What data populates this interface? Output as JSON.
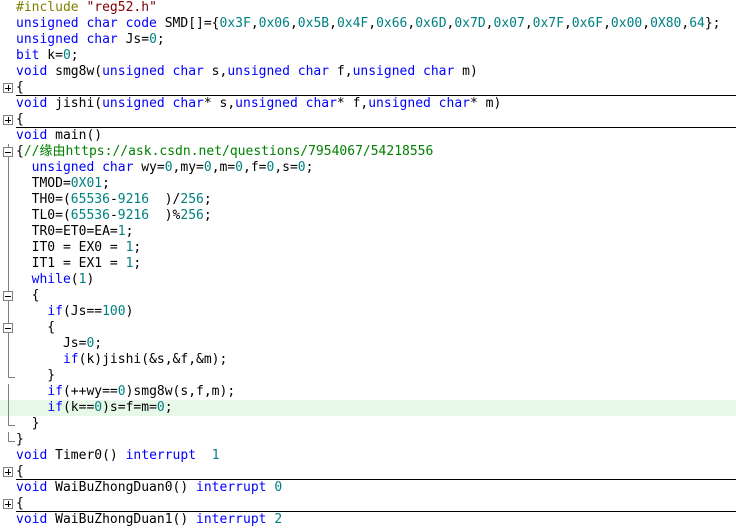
{
  "editor": {
    "lines": [
      {
        "fold": "",
        "hl": false,
        "sep": false,
        "tokens": [
          [
            "pp",
            "#include "
          ],
          [
            "str",
            "\"reg52.h\""
          ]
        ]
      },
      {
        "fold": "",
        "hl": false,
        "sep": false,
        "tokens": [
          [
            "kw",
            "unsigned char code"
          ],
          [
            "id",
            " SMD[]={"
          ],
          [
            "num",
            "0x3F"
          ],
          [
            "id",
            ","
          ],
          [
            "num",
            "0x06"
          ],
          [
            "id",
            ","
          ],
          [
            "num",
            "0x5B"
          ],
          [
            "id",
            ","
          ],
          [
            "num",
            "0x4F"
          ],
          [
            "id",
            ","
          ],
          [
            "num",
            "0x66"
          ],
          [
            "id",
            ","
          ],
          [
            "num",
            "0x6D"
          ],
          [
            "id",
            ","
          ],
          [
            "num",
            "0x7D"
          ],
          [
            "id",
            ","
          ],
          [
            "num",
            "0x07"
          ],
          [
            "id",
            ","
          ],
          [
            "num",
            "0x7F"
          ],
          [
            "id",
            ","
          ],
          [
            "num",
            "0x6F"
          ],
          [
            "id",
            ","
          ],
          [
            "num",
            "0x00"
          ],
          [
            "id",
            ","
          ],
          [
            "num",
            "0X80"
          ],
          [
            "id",
            ","
          ],
          [
            "num",
            "64"
          ],
          [
            "id",
            "};"
          ]
        ]
      },
      {
        "fold": "",
        "hl": false,
        "sep": false,
        "tokens": [
          [
            "kw",
            "unsigned char"
          ],
          [
            "id",
            " Js="
          ],
          [
            "num",
            "0"
          ],
          [
            "id",
            ";"
          ]
        ]
      },
      {
        "fold": "",
        "hl": false,
        "sep": false,
        "tokens": [
          [
            "kw",
            "bit"
          ],
          [
            "id",
            " k="
          ],
          [
            "num",
            "0"
          ],
          [
            "id",
            ";"
          ]
        ]
      },
      {
        "fold": "",
        "hl": false,
        "sep": false,
        "tokens": [
          [
            "kw",
            "void"
          ],
          [
            "id",
            " smg8w("
          ],
          [
            "kw",
            "unsigned char"
          ],
          [
            "id",
            " s,"
          ],
          [
            "kw",
            "unsigned char"
          ],
          [
            "id",
            " f,"
          ],
          [
            "kw",
            "unsigned char"
          ],
          [
            "id",
            " m)"
          ]
        ]
      },
      {
        "fold": "plus",
        "hl": false,
        "sep": false,
        "tokens": [
          [
            "id",
            "{"
          ]
        ]
      },
      {
        "fold": "",
        "hl": false,
        "sep": true,
        "tokens": [
          [
            "kw",
            "void"
          ],
          [
            "id",
            " jishi("
          ],
          [
            "kw",
            "unsigned char"
          ],
          [
            "id",
            "* s,"
          ],
          [
            "kw",
            "unsigned char"
          ],
          [
            "id",
            "* f,"
          ],
          [
            "kw",
            "unsigned char"
          ],
          [
            "id",
            "* m)"
          ]
        ]
      },
      {
        "fold": "plus",
        "hl": false,
        "sep": false,
        "tokens": [
          [
            "id",
            "{"
          ]
        ]
      },
      {
        "fold": "",
        "hl": false,
        "sep": true,
        "tokens": [
          [
            "kw",
            "void"
          ],
          [
            "id",
            " main()"
          ]
        ]
      },
      {
        "fold": "minus",
        "hl": false,
        "sep": false,
        "tokens": [
          [
            "id",
            "{"
          ],
          [
            "cm",
            "//缘由https://ask.csdn.net/questions/7954067/54218556"
          ]
        ]
      },
      {
        "fold": "line",
        "hl": false,
        "sep": false,
        "tokens": [
          [
            "id",
            "  "
          ],
          [
            "kw",
            "unsigned char"
          ],
          [
            "id",
            " wy="
          ],
          [
            "num",
            "0"
          ],
          [
            "id",
            ",my="
          ],
          [
            "num",
            "0"
          ],
          [
            "id",
            ",m="
          ],
          [
            "num",
            "0"
          ],
          [
            "id",
            ",f="
          ],
          [
            "num",
            "0"
          ],
          [
            "id",
            ",s="
          ],
          [
            "num",
            "0"
          ],
          [
            "id",
            ";"
          ]
        ]
      },
      {
        "fold": "line",
        "hl": false,
        "sep": false,
        "tokens": [
          [
            "id",
            "  TMOD="
          ],
          [
            "num",
            "0X01"
          ],
          [
            "id",
            ";"
          ]
        ]
      },
      {
        "fold": "line",
        "hl": false,
        "sep": false,
        "tokens": [
          [
            "id",
            "  TH0=("
          ],
          [
            "num",
            "65536"
          ],
          [
            "id",
            "-"
          ],
          [
            "num",
            "9216"
          ],
          [
            "id",
            "  )/"
          ],
          [
            "num",
            "256"
          ],
          [
            "id",
            ";"
          ]
        ]
      },
      {
        "fold": "line",
        "hl": false,
        "sep": false,
        "tokens": [
          [
            "id",
            "  TL0=("
          ],
          [
            "num",
            "65536"
          ],
          [
            "id",
            "-"
          ],
          [
            "num",
            "9216"
          ],
          [
            "id",
            "  )%"
          ],
          [
            "num",
            "256"
          ],
          [
            "id",
            ";"
          ]
        ]
      },
      {
        "fold": "line",
        "hl": false,
        "sep": false,
        "tokens": [
          [
            "id",
            "  TR0=ET0=EA="
          ],
          [
            "num",
            "1"
          ],
          [
            "id",
            ";"
          ]
        ]
      },
      {
        "fold": "line",
        "hl": false,
        "sep": false,
        "tokens": [
          [
            "id",
            "  IT0 = EX0 = "
          ],
          [
            "num",
            "1"
          ],
          [
            "id",
            ";"
          ]
        ]
      },
      {
        "fold": "line",
        "hl": false,
        "sep": false,
        "tokens": [
          [
            "id",
            "  IT1 = EX1 = "
          ],
          [
            "num",
            "1"
          ],
          [
            "id",
            ";"
          ]
        ]
      },
      {
        "fold": "line",
        "hl": false,
        "sep": false,
        "tokens": [
          [
            "id",
            "  "
          ],
          [
            "kw",
            "while"
          ],
          [
            "id",
            "("
          ],
          [
            "num",
            "1"
          ],
          [
            "id",
            ")"
          ]
        ]
      },
      {
        "fold": "minus",
        "hl": false,
        "sep": false,
        "tokens": [
          [
            "id",
            "  {"
          ]
        ]
      },
      {
        "fold": "line",
        "hl": false,
        "sep": false,
        "tokens": [
          [
            "id",
            "    "
          ],
          [
            "kw",
            "if"
          ],
          [
            "id",
            "(Js=="
          ],
          [
            "num",
            "100"
          ],
          [
            "id",
            ")"
          ]
        ]
      },
      {
        "fold": "minus",
        "hl": false,
        "sep": false,
        "tokens": [
          [
            "id",
            "    {"
          ]
        ]
      },
      {
        "fold": "line",
        "hl": false,
        "sep": false,
        "tokens": [
          [
            "id",
            "      Js="
          ],
          [
            "num",
            "0"
          ],
          [
            "id",
            ";"
          ]
        ]
      },
      {
        "fold": "line",
        "hl": false,
        "sep": false,
        "tokens": [
          [
            "id",
            "      "
          ],
          [
            "kw",
            "if"
          ],
          [
            "id",
            "(k)jishi(&s,&f,&m);"
          ]
        ]
      },
      {
        "fold": "end",
        "hl": false,
        "sep": false,
        "tokens": [
          [
            "id",
            "    }"
          ]
        ]
      },
      {
        "fold": "line",
        "hl": false,
        "sep": false,
        "tokens": [
          [
            "id",
            "    "
          ],
          [
            "kw",
            "if"
          ],
          [
            "id",
            "(++wy=="
          ],
          [
            "num",
            "0"
          ],
          [
            "id",
            ")smg8w(s,f,m);"
          ]
        ]
      },
      {
        "fold": "line",
        "hl": true,
        "sep": false,
        "tokens": [
          [
            "id",
            "    "
          ],
          [
            "kw",
            "if"
          ],
          [
            "id",
            "(k=="
          ],
          [
            "num",
            "0"
          ],
          [
            "id",
            ")s=f=m="
          ],
          [
            "num",
            "0"
          ],
          [
            "id",
            ";"
          ]
        ]
      },
      {
        "fold": "end",
        "hl": false,
        "sep": false,
        "tokens": [
          [
            "id",
            "  }"
          ]
        ]
      },
      {
        "fold": "end",
        "hl": false,
        "sep": false,
        "tokens": [
          [
            "id",
            "}"
          ]
        ]
      },
      {
        "fold": "",
        "hl": false,
        "sep": false,
        "tokens": [
          [
            "kw",
            "void"
          ],
          [
            "id",
            " Timer0() "
          ],
          [
            "kw",
            "interrupt"
          ],
          [
            "id",
            "  "
          ],
          [
            "num",
            "1"
          ]
        ]
      },
      {
        "fold": "plus",
        "hl": false,
        "sep": false,
        "tokens": [
          [
            "id",
            "{"
          ]
        ]
      },
      {
        "fold": "",
        "hl": false,
        "sep": true,
        "tokens": [
          [
            "kw",
            "void"
          ],
          [
            "id",
            " WaiBuZhongDuan0() "
          ],
          [
            "kw",
            "interrupt"
          ],
          [
            "id",
            " "
          ],
          [
            "num",
            "0"
          ]
        ]
      },
      {
        "fold": "plus",
        "hl": false,
        "sep": false,
        "tokens": [
          [
            "id",
            "{"
          ]
        ]
      },
      {
        "fold": "",
        "hl": false,
        "sep": true,
        "tokens": [
          [
            "kw",
            "void"
          ],
          [
            "id",
            " WaiBuZhongDuan1() "
          ],
          [
            "kw",
            "interrupt"
          ],
          [
            "id",
            " "
          ],
          [
            "num",
            "2"
          ]
        ]
      }
    ]
  }
}
